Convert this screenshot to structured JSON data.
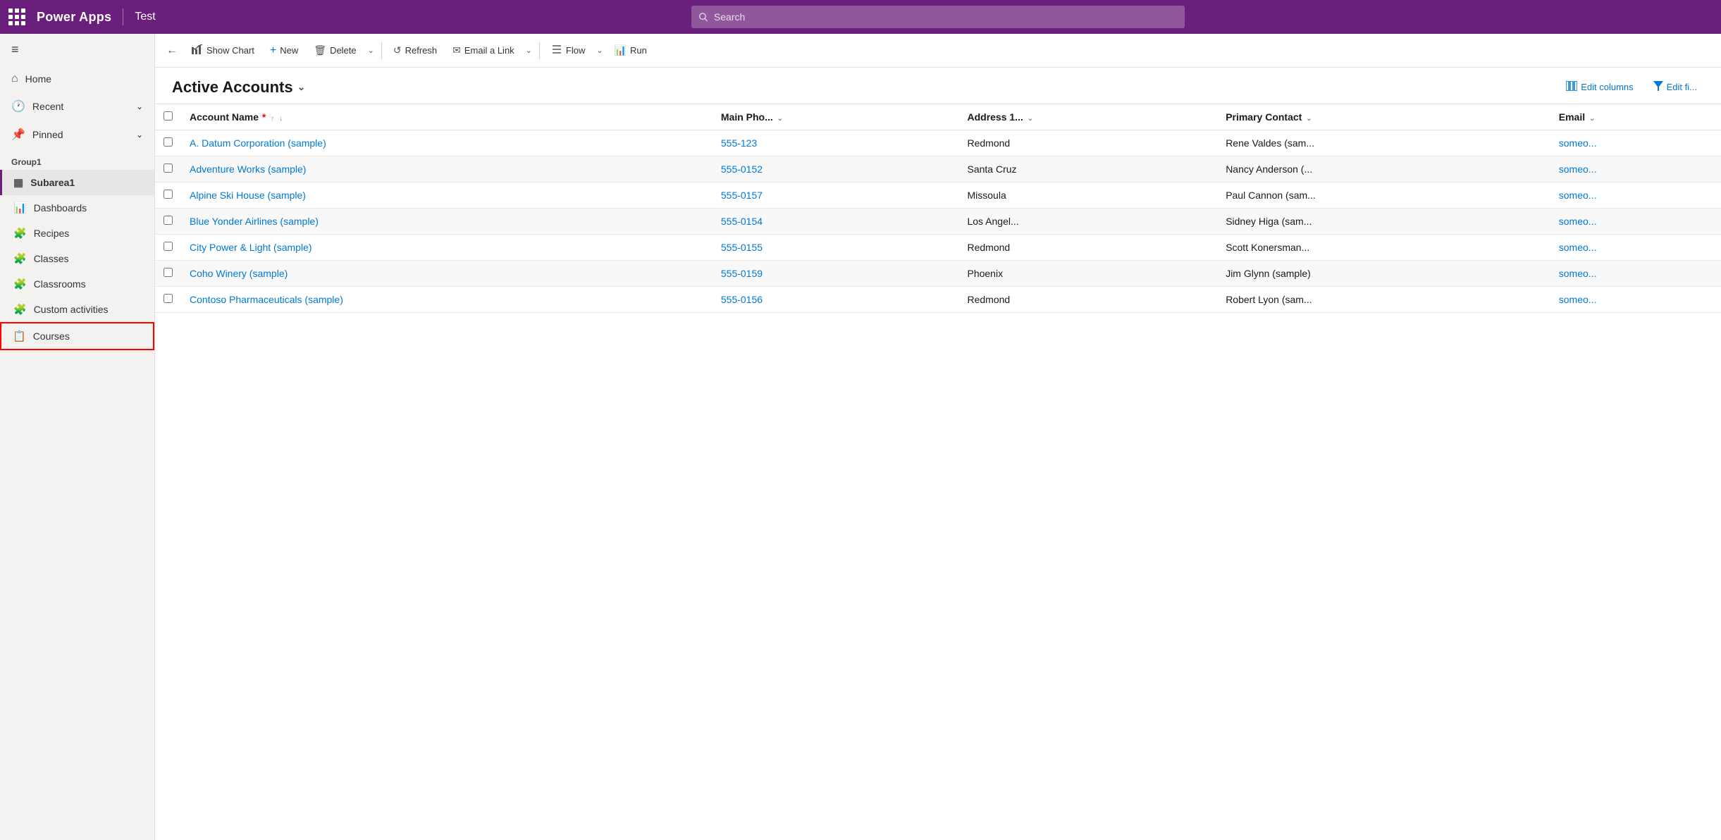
{
  "topbar": {
    "brand": "Power Apps",
    "divider": "|",
    "appname": "Test",
    "search_placeholder": "Search"
  },
  "sidebar": {
    "hamburger_icon": "≡",
    "nav": [
      {
        "id": "home",
        "icon": "⌂",
        "label": "Home",
        "chevron": ""
      },
      {
        "id": "recent",
        "icon": "🕐",
        "label": "Recent",
        "chevron": "⌄"
      },
      {
        "id": "pinned",
        "icon": "📌",
        "label": "Pinned",
        "chevron": "⌄"
      }
    ],
    "group_label": "Group1",
    "sub_items": [
      {
        "id": "subarea1",
        "icon": "▦",
        "label": "Subarea1",
        "active": true,
        "highlighted": false
      },
      {
        "id": "dashboards",
        "icon": "📊",
        "label": "Dashboards",
        "active": false,
        "highlighted": false
      },
      {
        "id": "recipes",
        "icon": "🧩",
        "label": "Recipes",
        "active": false,
        "highlighted": false
      },
      {
        "id": "classes",
        "icon": "🧩",
        "label": "Classes",
        "active": false,
        "highlighted": false
      },
      {
        "id": "classrooms",
        "icon": "🧩",
        "label": "Classrooms",
        "active": false,
        "highlighted": false
      },
      {
        "id": "custom-activities",
        "icon": "🧩",
        "label": "Custom activities",
        "active": false,
        "highlighted": false
      },
      {
        "id": "courses",
        "icon": "📋",
        "label": "Courses",
        "active": false,
        "highlighted": true
      }
    ]
  },
  "command_bar": {
    "back_icon": "←",
    "show_chart_icon": "📈",
    "show_chart_label": "Show Chart",
    "new_icon": "+",
    "new_label": "New",
    "delete_icon": "🗑",
    "delete_label": "Delete",
    "refresh_icon": "↺",
    "refresh_label": "Refresh",
    "email_link_icon": "✉",
    "email_link_label": "Email a Link",
    "flow_icon": "≋",
    "flow_label": "Flow",
    "run_icon": "📊",
    "run_label": "Run"
  },
  "view": {
    "title": "Active Accounts",
    "title_chevron": "⌄",
    "edit_columns_icon": "▦",
    "edit_columns_label": "Edit columns",
    "edit_filters_icon": "▼",
    "edit_filters_label": "Edit fi..."
  },
  "table": {
    "columns": [
      {
        "id": "account-name",
        "label": "Account Name",
        "required": true,
        "sort": true,
        "chevron": true
      },
      {
        "id": "main-phone",
        "label": "Main Pho...",
        "chevron": true
      },
      {
        "id": "address",
        "label": "Address 1...",
        "chevron": true
      },
      {
        "id": "primary-contact",
        "label": "Primary Contact",
        "chevron": true
      },
      {
        "id": "email",
        "label": "Email",
        "chevron": true
      }
    ],
    "rows": [
      {
        "account_name": "A. Datum Corporation (sample)",
        "main_phone": "555-123",
        "address": "Redmond",
        "primary_contact": "Rene Valdes (sam...",
        "email": "someo..."
      },
      {
        "account_name": "Adventure Works (sample)",
        "main_phone": "555-0152",
        "address": "Santa Cruz",
        "primary_contact": "Nancy Anderson (...",
        "email": "someo..."
      },
      {
        "account_name": "Alpine Ski House (sample)",
        "main_phone": "555-0157",
        "address": "Missoula",
        "primary_contact": "Paul Cannon (sam...",
        "email": "someo..."
      },
      {
        "account_name": "Blue Yonder Airlines (sample)",
        "main_phone": "555-0154",
        "address": "Los Angel...",
        "primary_contact": "Sidney Higa (sam...",
        "email": "someo..."
      },
      {
        "account_name": "City Power & Light (sample)",
        "main_phone": "555-0155",
        "address": "Redmond",
        "primary_contact": "Scott Konersman...",
        "email": "someo..."
      },
      {
        "account_name": "Coho Winery (sample)",
        "main_phone": "555-0159",
        "address": "Phoenix",
        "primary_contact": "Jim Glynn (sample)",
        "email": "someo..."
      },
      {
        "account_name": "Contoso Pharmaceuticals (sample)",
        "main_phone": "555-0156",
        "address": "Redmond",
        "primary_contact": "Robert Lyon (sam...",
        "email": "someo..."
      }
    ]
  }
}
